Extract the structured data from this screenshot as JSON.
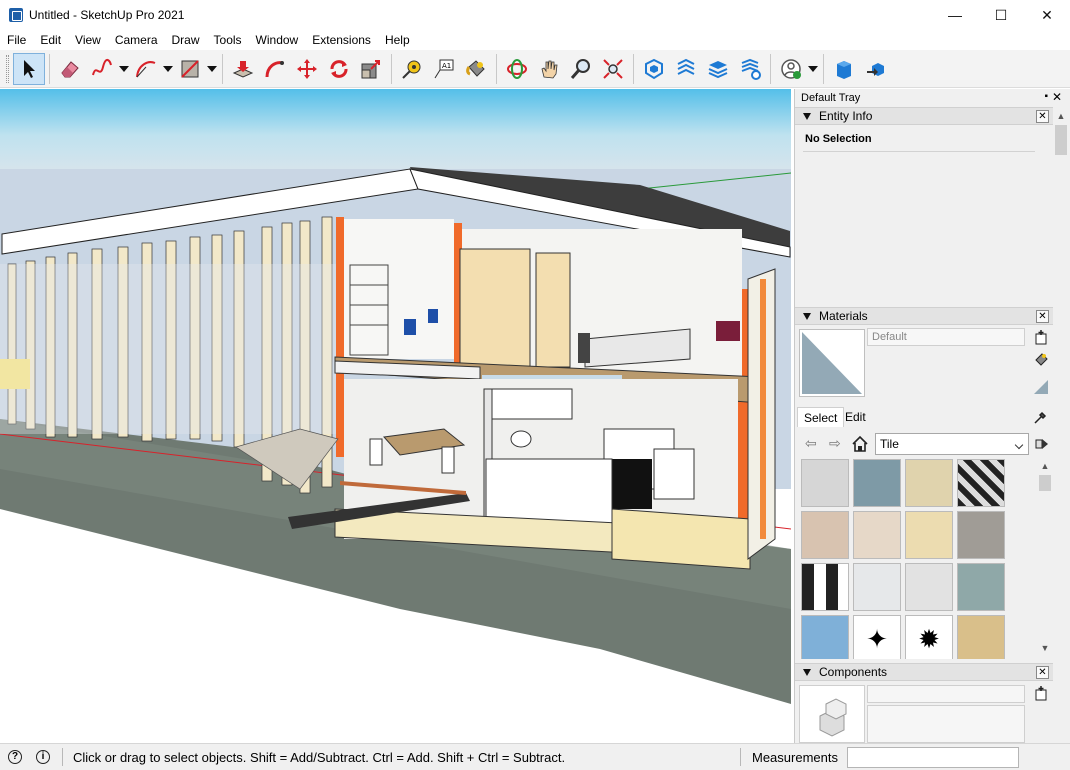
{
  "window": {
    "title": "Untitled - SketchUp Pro 2021",
    "minimize": "—",
    "maximize": "☐",
    "close": "✕"
  },
  "menu": [
    "File",
    "Edit",
    "View",
    "Camera",
    "Draw",
    "Tools",
    "Window",
    "Extensions",
    "Help"
  ],
  "toolbar": {
    "tools": [
      "select",
      "eraser",
      "freehand",
      "arc",
      "rectangle",
      "push-pull",
      "follow-me",
      "move",
      "rotate",
      "scale",
      "tape-measure",
      "text",
      "paint-bucket",
      "orbit",
      "pan",
      "zoom",
      "zoom-extents",
      "3d-warehouse",
      "extension-warehouse",
      "layout",
      "extension-manager",
      "profile",
      "solid-tools",
      "send-to-layout"
    ],
    "accent": "#1e7ad4"
  },
  "tray": {
    "title": "Default Tray",
    "entity_info": {
      "header": "Entity Info",
      "selection": "No Selection"
    },
    "materials": {
      "header": "Materials",
      "material_name": "Default",
      "tabs": [
        "Select",
        "Edit"
      ],
      "collection": "Tile",
      "swatch_colors": [
        "#d6d6d6",
        "#7e9aa6",
        "#e0d3ad",
        "#8a8a8a",
        "#d8c3b0",
        "#e6d8c8",
        "#ecdcb0",
        "#a09c96",
        "#555555",
        "#e6e8ea",
        "#e2e2e2",
        "#8fa8a8",
        "#7fb0d8",
        "#ffffff",
        "#ffffff",
        "#d9bf8a"
      ]
    },
    "components": {
      "header": "Components"
    }
  },
  "status": {
    "hint": "Click or drag to select objects. Shift = Add/Subtract. Ctrl = Add. Shift + Ctrl = Subtract.",
    "measurements_label": "Measurements",
    "measurements_value": ""
  },
  "viewport": {
    "sky_color": "#c9d6e4",
    "ground_color": "#6f7a72"
  }
}
